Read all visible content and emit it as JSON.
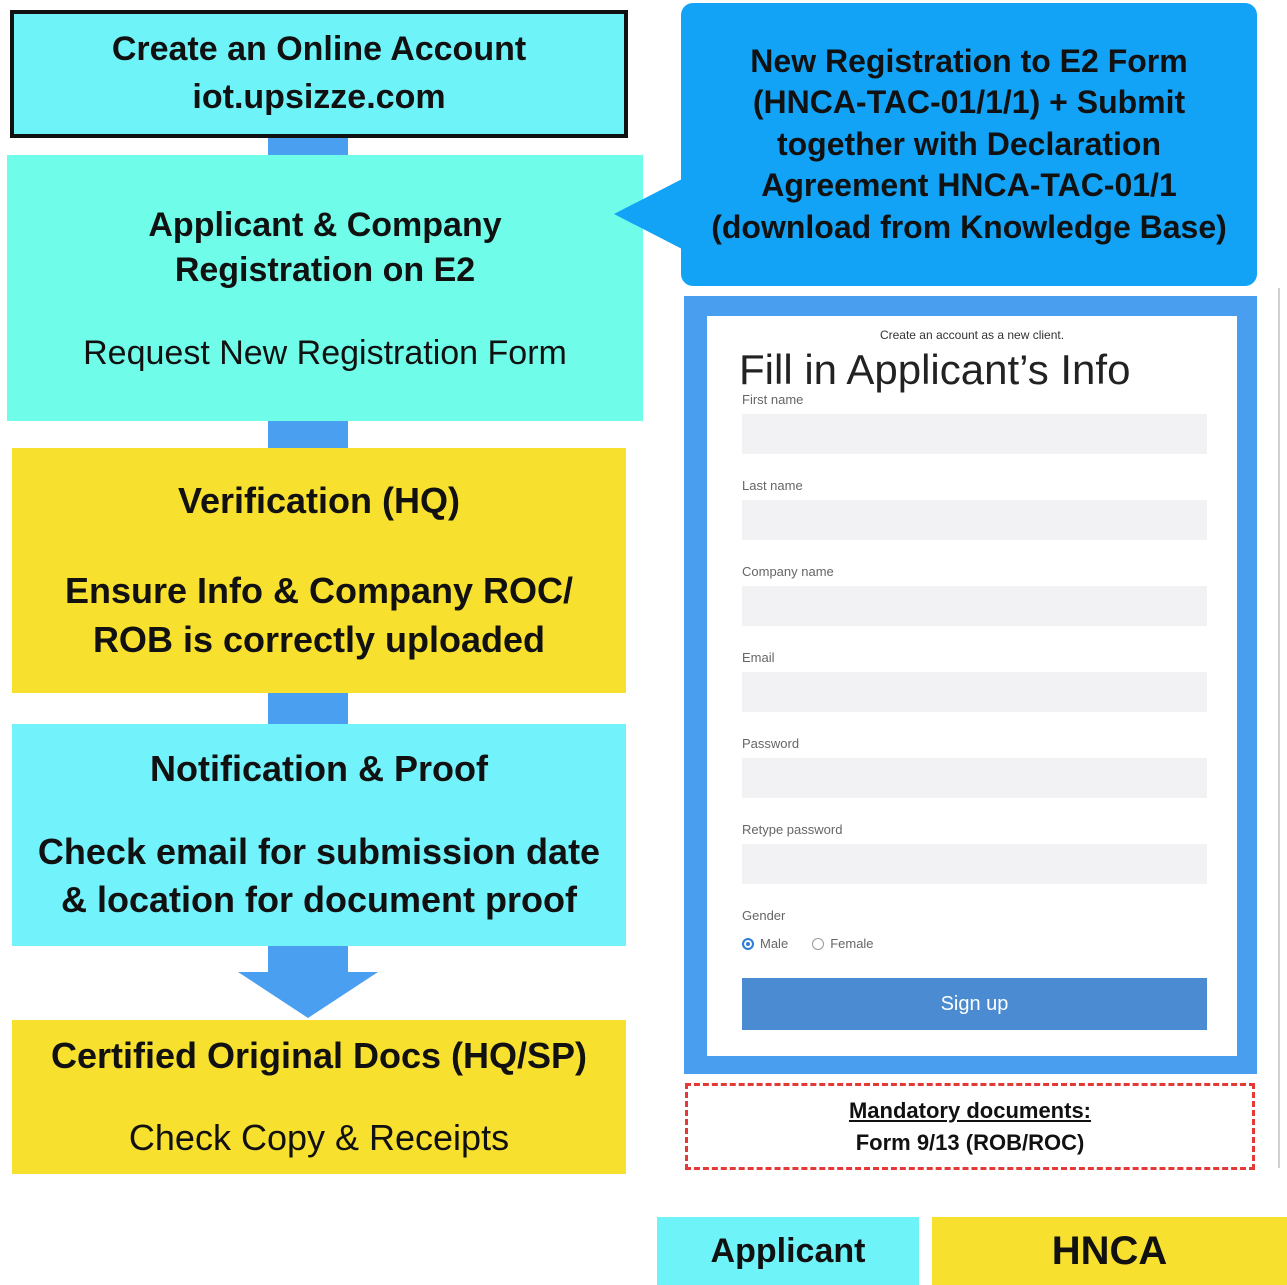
{
  "steps": {
    "create_account": {
      "title": "Create an Online Account",
      "subtitle": "iot.upsizze.com"
    },
    "registration": {
      "title_line1": "Applicant & Company",
      "title_line2": "Registration on E2",
      "subtitle": "Request New Registration Form"
    },
    "verification": {
      "title": "Verification (HQ)",
      "line1": "Ensure Info & Company ROC/",
      "line2": "ROB is correctly uploaded"
    },
    "notification": {
      "title": "Notification & Proof",
      "line1": "Check email for submission date",
      "line2": "& location for document proof"
    },
    "certified": {
      "title": "Certified Original Docs (HQ/SP)",
      "subtitle": "Check Copy & Receipts"
    }
  },
  "callout": {
    "line1": "New Registration to E2 Form",
    "line2": "(HNCA-TAC-01/1/1) + Submit",
    "line3": "together with Declaration",
    "line4": "Agreement HNCA-TAC-01/1",
    "line5": "(download from Knowledge Base)"
  },
  "form": {
    "small_title": "Create an account as a new client.",
    "heading": "Fill in Applicant’s Info",
    "fields": {
      "first_name": "First name",
      "last_name": "Last name",
      "company_name": "Company name",
      "email": "Email",
      "password": "Password",
      "retype_password": "Retype password"
    },
    "gender_label": "Gender",
    "gender_male": "Male",
    "gender_female": "Female",
    "signup": "Sign up"
  },
  "mandatory": {
    "title": "Mandatory documents:",
    "item": "Form 9/13 (ROB/ROC)"
  },
  "legend": {
    "applicant": "Applicant",
    "hnca": "HNCA"
  },
  "colors": {
    "applicant": "#6ef3f9",
    "hnca": "#f8e02e",
    "callout": "#12a3f7",
    "connector": "#4a9ff0"
  }
}
